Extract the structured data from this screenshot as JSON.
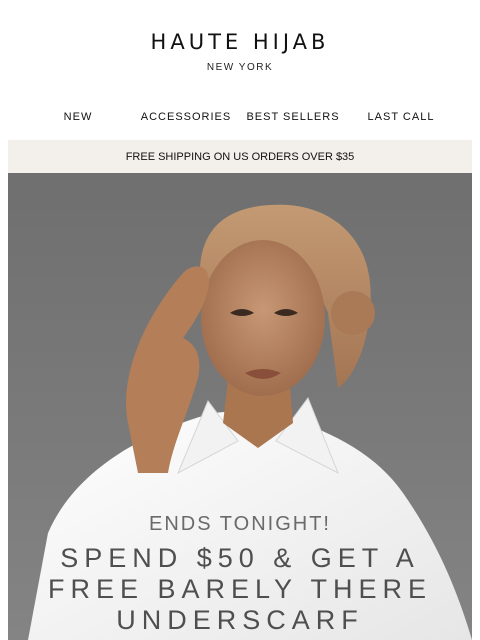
{
  "brand": {
    "name": "HAUTE HIJAB",
    "location": "NEW YORK"
  },
  "nav": {
    "items": [
      {
        "label": "NEW"
      },
      {
        "label": "ACCESSORIES"
      },
      {
        "label": "BEST SELLERS"
      },
      {
        "label": "LAST CALL"
      }
    ]
  },
  "banner": {
    "text": "FREE SHIPPING ON US ORDERS OVER $35"
  },
  "hero": {
    "kicker": "ENDS TONIGHT!",
    "headline_lines": [
      "SPEND $50 & GET A",
      "FREE BARELY THERE",
      "UNDERSCARF"
    ],
    "colors": {
      "background": "#777777",
      "text": "#4f4f4f",
      "shirt": "#f7f7f7",
      "cap": "#b58b63"
    }
  }
}
